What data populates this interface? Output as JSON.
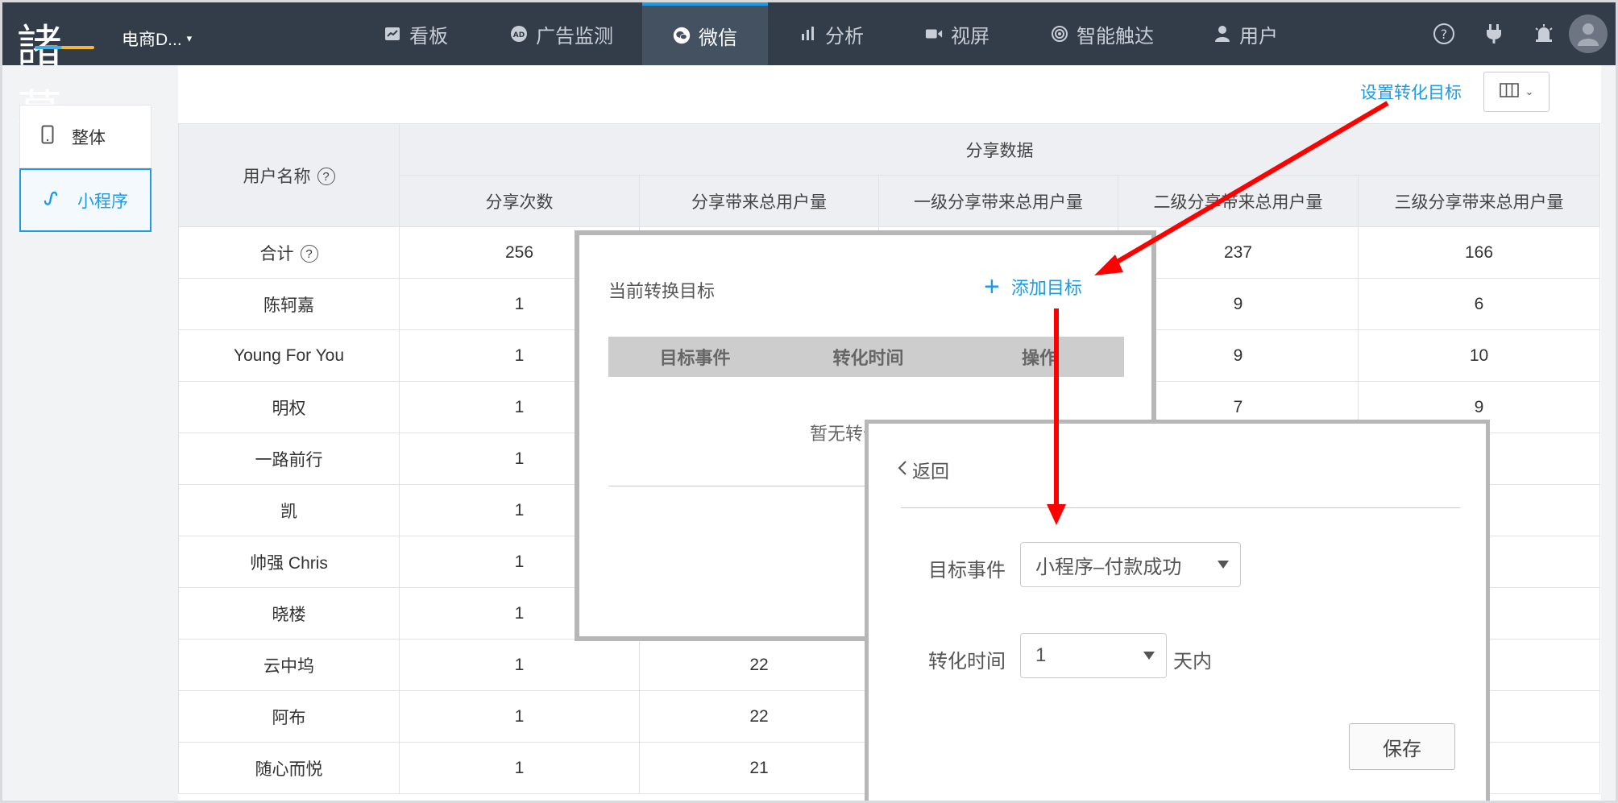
{
  "brand": {
    "logo_text": "諸葛"
  },
  "header": {
    "project": "电商D...",
    "nav": [
      {
        "label": "看板",
        "icon": "chart-icon"
      },
      {
        "label": "广告监测",
        "icon": "ad-icon"
      },
      {
        "label": "微信",
        "icon": "wechat-icon",
        "active": true
      },
      {
        "label": "分析",
        "icon": "bar-icon"
      },
      {
        "label": "视屏",
        "icon": "video-icon"
      },
      {
        "label": "智能触达",
        "icon": "target-icon"
      },
      {
        "label": "用户",
        "icon": "user-icon"
      }
    ]
  },
  "sidebar": {
    "items": [
      {
        "label": "整体"
      },
      {
        "label": "小程序",
        "active": true
      }
    ]
  },
  "toolbar": {
    "set_goal": "设置转化目标"
  },
  "table": {
    "user_col": "用户名称",
    "group_header": "分享数据",
    "columns": [
      "分享次数",
      "分享带来总用户量",
      "一级分享带来总用户量",
      "二级分享带来总用户量",
      "三级分享带来总用户量"
    ],
    "rows": [
      {
        "name": "合计",
        "help": true,
        "cells": [
          "256",
          "",
          "",
          "237",
          "166"
        ]
      },
      {
        "name": "陈轲嘉",
        "cells": [
          "1",
          "",
          "",
          "9",
          "6"
        ]
      },
      {
        "name": "Young For You",
        "cells": [
          "1",
          "",
          "",
          "9",
          "10"
        ]
      },
      {
        "name": "明权",
        "cells": [
          "1",
          "",
          "",
          "7",
          "9"
        ]
      },
      {
        "name": "一路前行",
        "cells": [
          "1",
          "",
          "",
          "",
          ""
        ]
      },
      {
        "name": "凯",
        "cells": [
          "1",
          "",
          "",
          "",
          ""
        ]
      },
      {
        "name": "帅强 Chris",
        "cells": [
          "1",
          "",
          "",
          "",
          ""
        ]
      },
      {
        "name": "晓楼",
        "cells": [
          "1",
          "",
          "",
          "",
          ""
        ]
      },
      {
        "name": "云中坞",
        "cells": [
          "1",
          "22",
          "",
          "",
          ""
        ]
      },
      {
        "name": "阿布",
        "cells": [
          "1",
          "22",
          "",
          "",
          ""
        ]
      },
      {
        "name": "随心而悦",
        "cells": [
          "1",
          "21",
          "",
          "",
          ""
        ]
      }
    ]
  },
  "goal_popup": {
    "title": "当前转换目标",
    "add": "添加目标",
    "columns": [
      "目标事件",
      "转化时间",
      "操作"
    ],
    "empty": "暂无转化目标"
  },
  "add_popup": {
    "back": "返回",
    "event_label": "目标事件",
    "event_value": "小程序–付款成功",
    "time_label": "转化时间",
    "time_value": "1",
    "time_suffix": "天内",
    "save": "保存"
  },
  "colors": {
    "accent": "#1e9be6",
    "nav_bg": "#333d4a",
    "arrow": "#ff0000"
  }
}
